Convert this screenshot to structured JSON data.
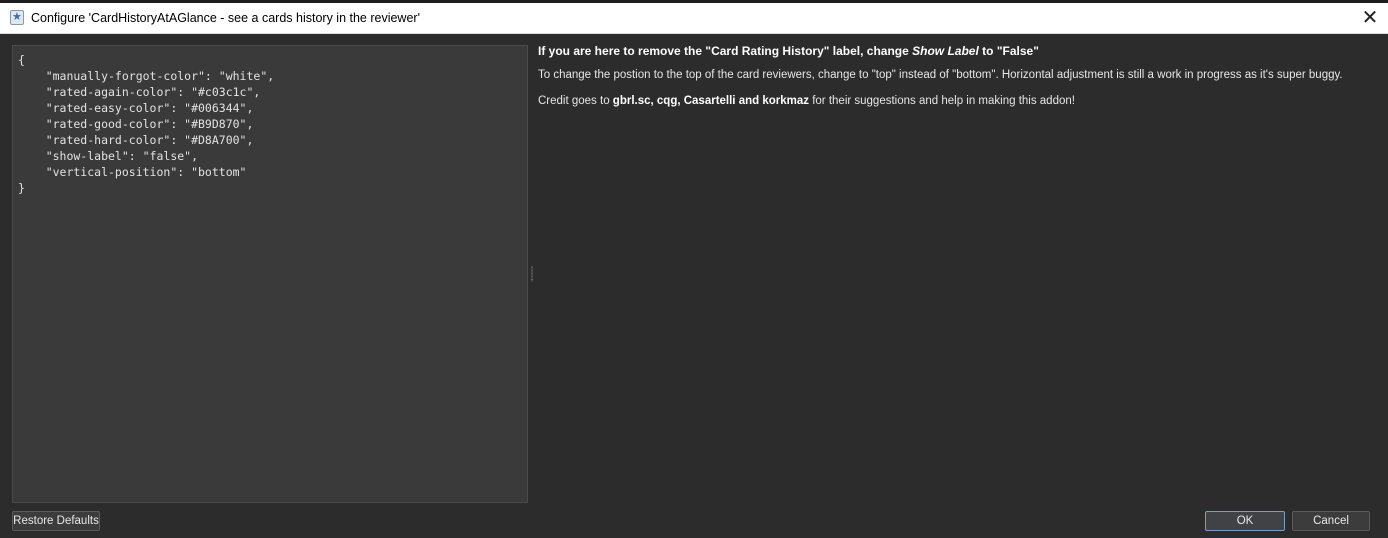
{
  "window": {
    "title": "Configure 'CardHistoryAtAGlance - see a cards history in the reviewer'",
    "close_glyph": "✕",
    "icon": "anki-star-icon"
  },
  "editor": {
    "lines": [
      "{",
      "    \"manually-forgot-color\": \"white\",",
      "    \"rated-again-color\": \"#c03c1c\",",
      "    \"rated-easy-color\": \"#006344\",",
      "    \"rated-good-color\": \"#B9D870\",",
      "    \"rated-hard-color\": \"#D8A700\",",
      "    \"show-label\": \"false\",",
      "    \"vertical-position\": \"bottom\"",
      "}"
    ]
  },
  "help": {
    "heading_before": "If you are here to remove the \"Card Rating History\" label, change ",
    "heading_em": "Show Label",
    "heading_after": " to \"False\"",
    "paragraph1": "To change the postion to the top of the card reviewers, change to \"top\" instead of \"bottom\". Horizontal adjustment is still a work in progress as it's super buggy.",
    "credit_before": "Credit goes to ",
    "credit_names": "gbrl.sc, cqg, Casartelli and korkmaz",
    "credit_after": " for their suggestions and help in making this addon!"
  },
  "buttons": {
    "restore_defaults": "Restore Defaults",
    "ok": "OK",
    "cancel": "Cancel"
  },
  "colors": {
    "window_bg": "#2c2c2c",
    "editor_bg": "#3a3a3a",
    "titlebar_bg": "#ffffff",
    "ok_border": "#7a9cc8"
  }
}
